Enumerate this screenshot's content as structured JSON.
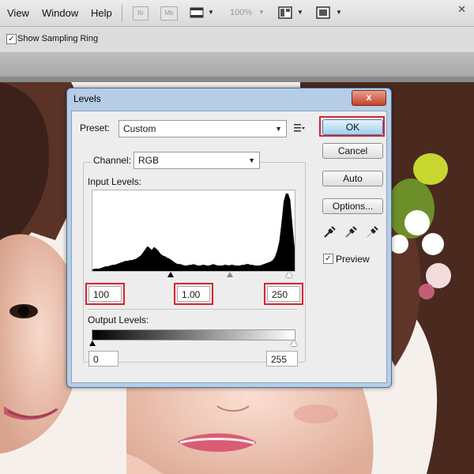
{
  "menu": {
    "view": "View",
    "window": "Window",
    "help": "Help"
  },
  "toolbar": {
    "bridge_label": "Br",
    "minibridge_label": "Mb",
    "zoom": "100%",
    "close_icon": "close-icon"
  },
  "options_bar": {
    "show_sampling_ring_label": "Show Sampling Ring",
    "show_sampling_ring_checked": true
  },
  "dialog": {
    "title": "Levels",
    "close_label": "x",
    "preset": {
      "label": "Preset:",
      "value": "Custom"
    },
    "channel": {
      "label": "Channel:",
      "value": "RGB"
    },
    "input_levels": {
      "label": "Input Levels:",
      "black": "100",
      "gamma": "1.00",
      "white": "250"
    },
    "output_levels": {
      "label": "Output Levels:",
      "black": "0",
      "white": "255"
    },
    "buttons": {
      "ok": "OK",
      "cancel": "Cancel",
      "auto": "Auto",
      "options": "Options..."
    },
    "preview": {
      "label": "Preview",
      "checked": true
    },
    "histogram": [
      2,
      3,
      3,
      3,
      4,
      5,
      6,
      6,
      7,
      8,
      8,
      9,
      10,
      11,
      12,
      13,
      13,
      14,
      14,
      15,
      16,
      18,
      20,
      24,
      28,
      32,
      30,
      27,
      31,
      29,
      26,
      22,
      20,
      19,
      17,
      16,
      14,
      12,
      10,
      9,
      9,
      8,
      7,
      7,
      8,
      8,
      9,
      8,
      7,
      7,
      8,
      8,
      7,
      7,
      8,
      9,
      8,
      7,
      7,
      7,
      8,
      8,
      7,
      8,
      8,
      7,
      7,
      7,
      8,
      8,
      9,
      9,
      8,
      8,
      7,
      7,
      7,
      8,
      9,
      10,
      11,
      12,
      14,
      18,
      26,
      38,
      62,
      90,
      100,
      100,
      92,
      60,
      30
    ]
  },
  "accent_colors": {
    "highlight_red": "#d8242f",
    "dialog_frame": "#b6cde6"
  }
}
